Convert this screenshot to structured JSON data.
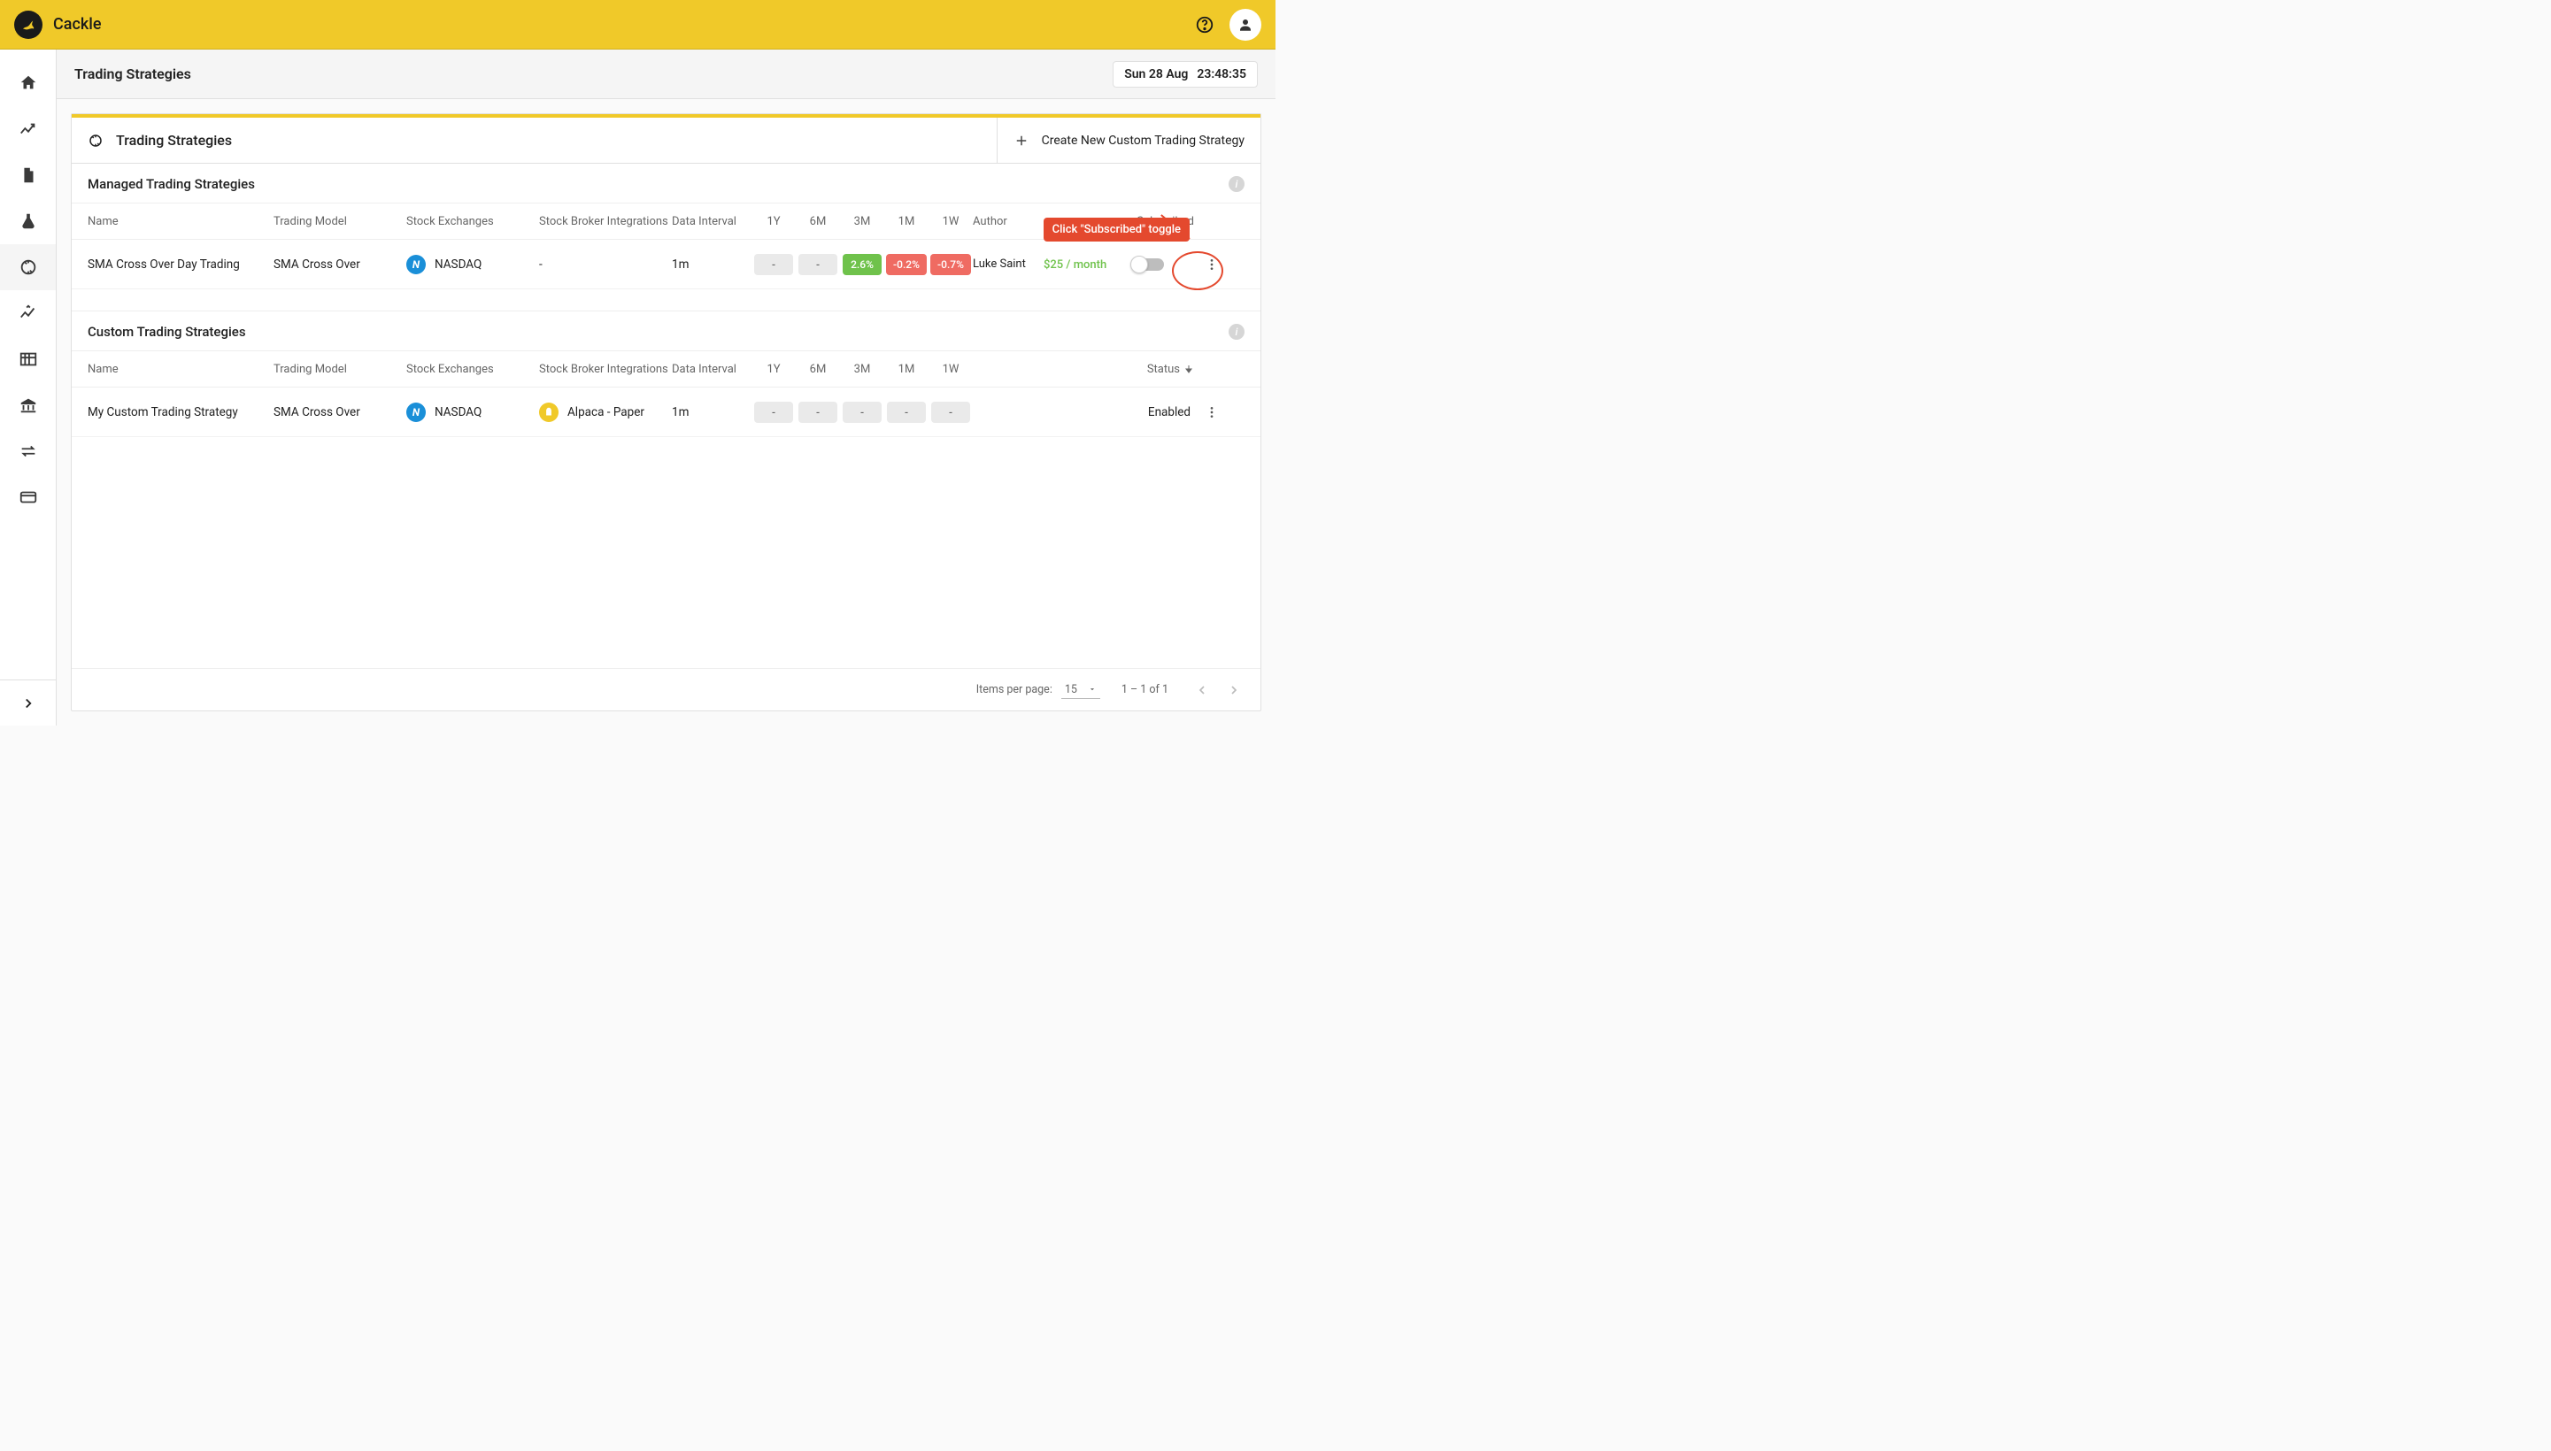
{
  "brand": {
    "name": "Cackle"
  },
  "header": {
    "datetime_date": "Sun 28 Aug",
    "datetime_time": "23:48:35"
  },
  "page": {
    "title": "Trading Strategies"
  },
  "card": {
    "title": "Trading Strategies",
    "create_button": "Create New Custom Trading Strategy"
  },
  "callout": {
    "text": "Click \"Subscribed\" toggle"
  },
  "managed": {
    "section_title": "Managed Trading Strategies",
    "columns": {
      "name": "Name",
      "model": "Trading Model",
      "exchanges": "Stock Exchanges",
      "brokers": "Stock Broker Integrations",
      "interval": "Data Interval",
      "y1": "1Y",
      "m6": "6M",
      "m3": "3M",
      "m1": "1M",
      "w1": "1W",
      "author": "Author",
      "subscribed": "Subscribed"
    },
    "rows": [
      {
        "name": "SMA Cross Over Day Trading",
        "model": "SMA Cross Over",
        "exchange": "NASDAQ",
        "broker": "-",
        "interval": "1m",
        "perf": {
          "y1": "-",
          "m6": "-",
          "m3": "2.6%",
          "m1": "-0.2%",
          "w1": "-0.7%"
        },
        "author": "Luke Saint",
        "price": "$25 / month"
      }
    ]
  },
  "custom": {
    "section_title": "Custom Trading Strategies",
    "columns": {
      "name": "Name",
      "model": "Trading Model",
      "exchanges": "Stock Exchanges",
      "brokers": "Stock Broker Integrations",
      "interval": "Data Interval",
      "y1": "1Y",
      "m6": "6M",
      "m3": "3M",
      "m1": "1M",
      "w1": "1W",
      "status": "Status"
    },
    "rows": [
      {
        "name": "My Custom Trading Strategy",
        "model": "SMA Cross Over",
        "exchange": "NASDAQ",
        "broker": "Alpaca - Paper",
        "interval": "1m",
        "perf": {
          "y1": "-",
          "m6": "-",
          "m3": "-",
          "m1": "-",
          "w1": "-"
        },
        "status": "Enabled"
      }
    ]
  },
  "paginator": {
    "items_label": "Items per page:",
    "page_size": "15",
    "range": "1 – 1 of 1"
  }
}
